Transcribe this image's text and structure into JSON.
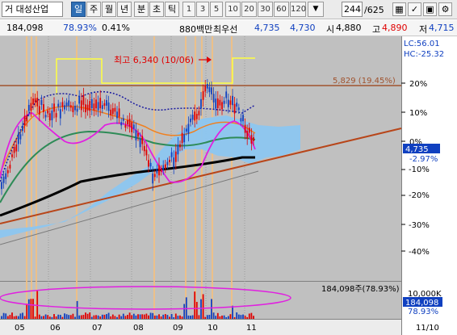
{
  "toolbar": {
    "stock_name": "거 대성산업",
    "periods": [
      "일",
      "주",
      "월",
      "년",
      "분",
      "초",
      "틱"
    ],
    "active_period": "일",
    "intervals": [
      "1",
      "3",
      "5",
      "10",
      "20",
      "30",
      "60",
      "120"
    ],
    "count_value": "244",
    "count_total": "/625",
    "icons": [
      "grid-icon",
      "indicator-icon",
      "save-icon",
      "settings-icon"
    ]
  },
  "info": {
    "volume": "184,098",
    "volume_rate": "78.93%",
    "change_pct": "0.41%",
    "trade_amount": "880백만",
    "best_label": "최우선",
    "ask_best": "4,735",
    "bid_best": "4,730",
    "open_label": "시",
    "open": "4,880",
    "high_label": "고",
    "high": "4,890",
    "low_label": "저",
    "low": "4,715"
  },
  "chart": {
    "lc_label": "LC:56.01",
    "hc_label": "HC:-25.32",
    "peak_annotation": "최고 6,340 (10/06)",
    "resistance_label": "5,829 (19.45%)",
    "pct_ticks": [
      "20%",
      "10%",
      "0%",
      "-10%",
      "-20%",
      "-30%",
      "-40%"
    ],
    "current_price": "4,735",
    "current_change": "-2.97%",
    "volume_annotation": "184,098주(78.93%)",
    "volume_axis_max": "10,000K",
    "volume_current": "184,098",
    "volume_current_pct": "78.93%",
    "months": [
      "05",
      "06",
      "07",
      "08",
      "09",
      "10",
      "11"
    ],
    "right_date": "11/10",
    "colors": {
      "background": "#c0c0c0",
      "resistance": "#a0522d",
      "trendline": "#b8461a",
      "ma_black": "#000000",
      "ma_green": "#2e8b57",
      "ma_magenta": "#e020e0",
      "ma_blue_dotted": "#1a1aa0",
      "cloud": "#8cc6f0",
      "peak_marker": "#e00000",
      "up_candle": "#e00000",
      "down_candle": "#1040c0",
      "vertical_highlight": "#f4c080"
    }
  }
}
